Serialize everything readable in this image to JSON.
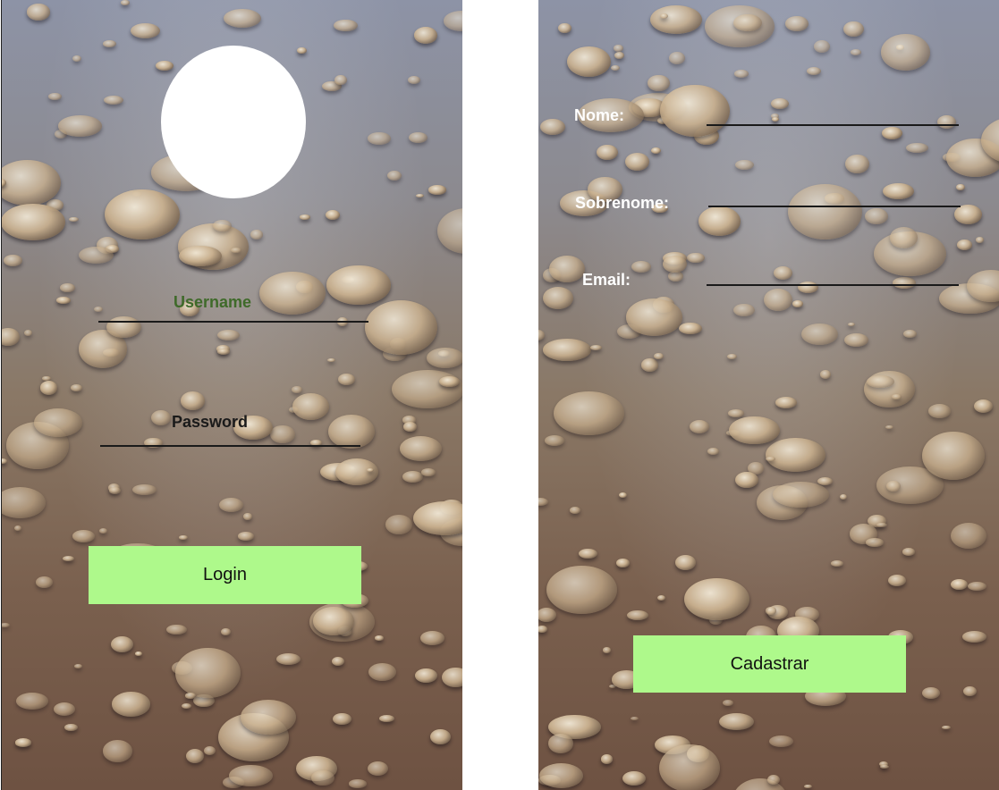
{
  "login": {
    "username_label": "Username",
    "password_label": "Password",
    "login_button": "Login"
  },
  "signup": {
    "nome_label": "Nome:",
    "sobrenome_label": "Sobrenome:",
    "email_label": "Email:",
    "submit_button": "Cadastrar"
  },
  "colors": {
    "button": "#aef98b",
    "username_label": "#3f6a2a",
    "password_label": "#1a1a1a",
    "signup_label": "#ffffff"
  }
}
